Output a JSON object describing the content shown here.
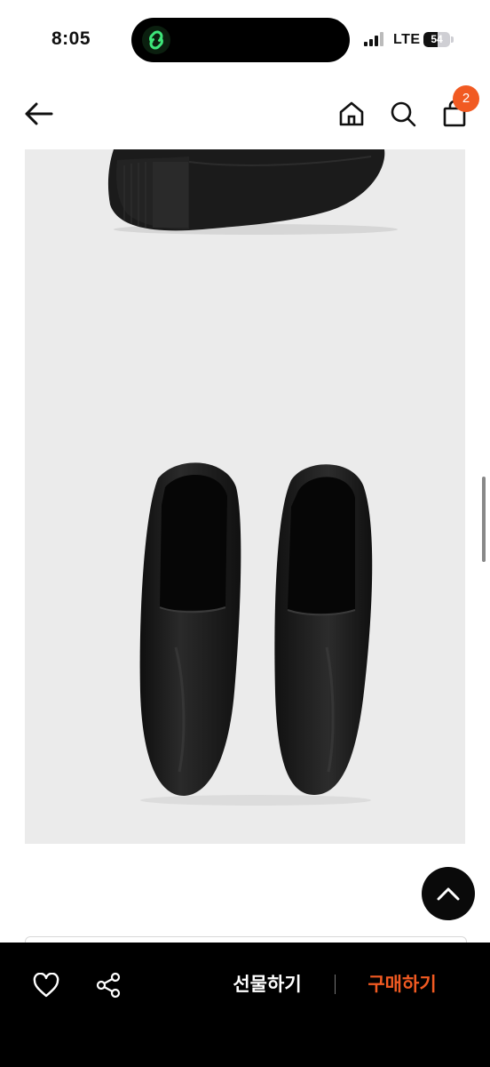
{
  "status_bar": {
    "time": "8:05",
    "network": "LTE",
    "battery_level": "54",
    "battery_percent": 54
  },
  "header": {
    "icons": [
      "back-arrow-icon",
      "home-icon",
      "search-icon",
      "shopping-bag-icon"
    ],
    "cart_count": "2"
  },
  "product": {
    "images": [
      "shoe-sole-photo",
      "black-leather-slip-on-photo"
    ],
    "background_color": "#ebebeb"
  },
  "bottom_bar": {
    "icons": [
      "heart-icon",
      "share-icon"
    ],
    "gift_label": "선물하기",
    "buy_label": "구매하기",
    "accent_color": "#f15a22"
  }
}
